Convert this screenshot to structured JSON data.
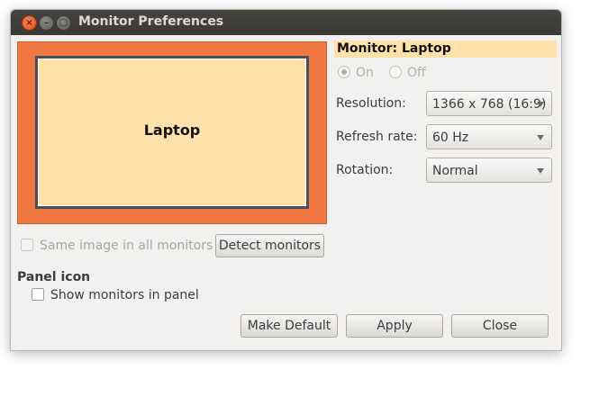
{
  "window": {
    "title": "Monitor Preferences",
    "controls": {
      "close": "×",
      "minimize": "–",
      "maximize": "□"
    }
  },
  "monitor_area": {
    "monitor_label": "Laptop",
    "colors": {
      "canvas": "#f07843",
      "monitor": "#ffe1a9"
    }
  },
  "details": {
    "monitor_name": "Monitor: Laptop",
    "power": {
      "on_label": "On",
      "off_label": "Off",
      "selected": "On"
    },
    "resolution_label": "Resolution:",
    "resolution_value": "1366 x 768 (16:9)",
    "refresh_label": "Refresh rate:",
    "refresh_value": "60 Hz",
    "rotation_label": "Rotation:",
    "rotation_value": "Normal"
  },
  "options": {
    "same_image_label": "Same image in all monitors",
    "same_image_checked": false,
    "detect_button": "Detect monitors",
    "panel_section": "Panel icon",
    "show_in_panel_label": "Show monitors in panel",
    "show_in_panel_checked": false
  },
  "buttons": {
    "make_default": "Make Default",
    "apply": "Apply",
    "close": "Close"
  }
}
